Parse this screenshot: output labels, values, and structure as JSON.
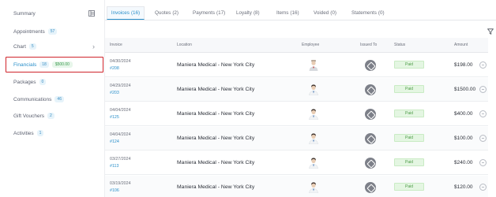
{
  "sidebar": {
    "items": [
      {
        "label": "Summary"
      },
      {
        "label": "Appointments",
        "badge": "57"
      },
      {
        "label": "Chart",
        "badge": "5"
      },
      {
        "label": "Financials",
        "badge": "18",
        "amount": "$500.00"
      },
      {
        "label": "Packages",
        "badge": "0"
      },
      {
        "label": "Communications",
        "badge": "46"
      },
      {
        "label": "Gift Vouchers",
        "badge": "2"
      },
      {
        "label": "Activities",
        "badge": "1"
      }
    ]
  },
  "tabs": [
    {
      "label": "Invoices",
      "count": "(16)"
    },
    {
      "label": "Quotes",
      "count": "(2)"
    },
    {
      "label": "Payments",
      "count": "(17)"
    },
    {
      "label": "Loyalty",
      "count": "(8)"
    },
    {
      "label": "Items",
      "count": "(16)"
    },
    {
      "label": "Voided",
      "count": "(0)"
    },
    {
      "label": "Statements",
      "count": "(0)"
    }
  ],
  "table": {
    "headers": {
      "invoice": "Invoice",
      "location": "Location",
      "employee": "Employee",
      "issued_to": "Issued To",
      "status": "Status",
      "amount": "Amount"
    },
    "rows": [
      {
        "date": "04/30/2024",
        "number": "#208",
        "location": "Maniera Medical - New York City",
        "status": "Paid",
        "amount": "$198.00"
      },
      {
        "date": "04/29/2024",
        "number": "#203",
        "location": "Maniera Medical - New York City",
        "status": "Paid",
        "amount": "$1500.00"
      },
      {
        "date": "04/04/2024",
        "number": "#125",
        "location": "Maniera Medical - New York City",
        "status": "Paid",
        "amount": "$400.00"
      },
      {
        "date": "04/04/2024",
        "number": "#124",
        "location": "Maniera Medical - New York City",
        "status": "Paid",
        "amount": "$100.00"
      },
      {
        "date": "03/27/2024",
        "number": "#113",
        "location": "Maniera Medical - New York City",
        "status": "Paid",
        "amount": "$240.00"
      },
      {
        "date": "03/19/2024",
        "number": "#106",
        "location": "Maniera Medical - New York City",
        "status": "Paid",
        "amount": "$120.00"
      }
    ]
  }
}
